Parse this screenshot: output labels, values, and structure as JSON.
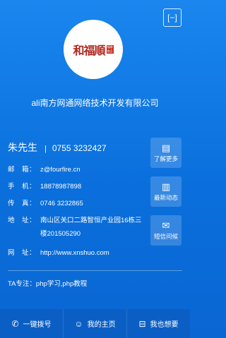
{
  "header": {
    "scan_icon": "scan-icon",
    "scan_glyph": "[−]"
  },
  "logo": {
    "text": "和福順",
    "seal_line1": "福順",
    "seal_line2": "食品"
  },
  "company": "ali南方网通网络技术开发有限公司",
  "contact": {
    "name": "朱先生",
    "separator": "|",
    "phone": "0755 3232427"
  },
  "info": [
    {
      "label": "邮　箱：",
      "value": "z@fourfire.cn"
    },
    {
      "label": "手　机：",
      "value": "18878987898"
    },
    {
      "label": "传　真：",
      "value": "0746 3232865"
    },
    {
      "label": "地　址：",
      "value": "南山区关口二路智恒产业园16栋三楼201505290"
    },
    {
      "label": "网　址：",
      "value": "http://www.xnshuo.com"
    }
  ],
  "side_buttons": [
    {
      "icon": "document-icon",
      "glyph": "▤",
      "label": "了解更多"
    },
    {
      "icon": "news-icon",
      "glyph": "▥",
      "label": "最新动态"
    },
    {
      "icon": "mail-icon",
      "glyph": "✉",
      "label": "短信问候"
    }
  ],
  "ta_note": "TA专注：php学习,php教程",
  "bottom_tabs": [
    {
      "icon": "phone-icon",
      "glyph": "✆",
      "label": "一键拨号"
    },
    {
      "icon": "user-icon",
      "glyph": "☺",
      "label": "我的主页"
    },
    {
      "icon": "wish-icon",
      "glyph": "⊟",
      "label": "我也想要"
    }
  ]
}
